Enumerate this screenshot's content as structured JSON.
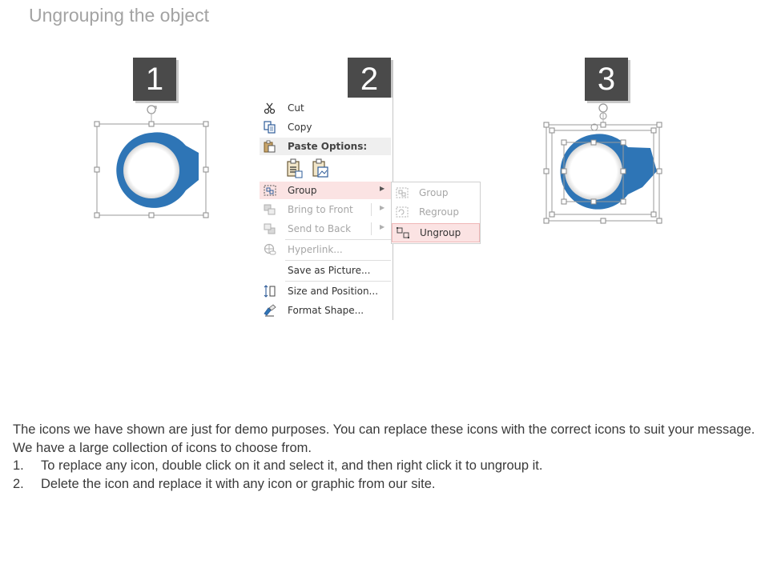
{
  "title": "Ungrouping the object",
  "steps": [
    "1",
    "2",
    "3"
  ],
  "context_menu": {
    "items": [
      {
        "label": "Cut",
        "icon": "scissors-icon"
      },
      {
        "label": "Copy",
        "icon": "copy-icon"
      },
      {
        "label": "Paste Options:",
        "icon": "paste-icon"
      },
      {
        "label": "Group",
        "icon": "group-icon",
        "highlighted": true
      },
      {
        "label": "Bring to Front",
        "icon": "bring-to-front-icon",
        "disabled": true
      },
      {
        "label": "Send to Back",
        "icon": "send-to-back-icon",
        "disabled": true
      },
      {
        "label": "Hyperlink...",
        "icon": "hyperlink-icon",
        "disabled": true
      },
      {
        "label": "Save as Picture...",
        "icon": ""
      },
      {
        "label": "Size and Position...",
        "icon": "size-position-icon"
      },
      {
        "label": "Format Shape...",
        "icon": "format-shape-icon"
      }
    ]
  },
  "submenu": {
    "items": [
      {
        "label": "Group",
        "icon": "group-icon",
        "disabled": true
      },
      {
        "label": "Regroup",
        "icon": "regroup-icon",
        "disabled": true
      },
      {
        "label": "Ungroup",
        "icon": "ungroup-icon",
        "highlighted": true
      }
    ]
  },
  "body": {
    "intro": "The icons we have shown are just for demo purposes. You can replace these icons with the correct icons to suit your message. We have a large collection of icons to choose from.",
    "steps": [
      {
        "num": "1.",
        "text": "To replace any icon, double click on it and select it, and then right click it to ungroup it."
      },
      {
        "num": "2.",
        "text": "Delete the icon and replace it with any icon or graphic from our site."
      }
    ]
  },
  "colors": {
    "accent_blue": "#2e75b6",
    "badge_dark": "#4a4a4a",
    "highlight": "#fbe3e3",
    "title_gray": "#a3a3a3"
  }
}
